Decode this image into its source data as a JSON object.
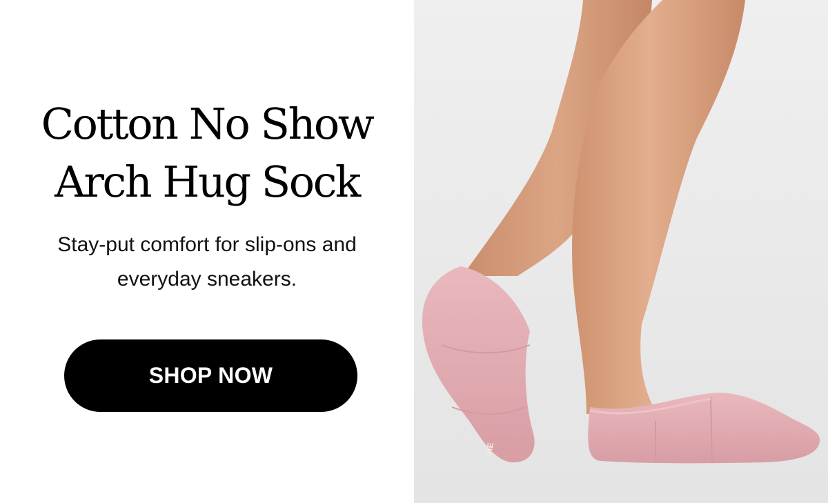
{
  "promo": {
    "headline_line1": "Cotton No Show",
    "headline_line2": "Arch Hug Sock",
    "subhead_line1": "Stay-put comfort for slip-ons and",
    "subhead_line2": "everyday sneakers.",
    "cta_label": "SHOP NOW"
  },
  "photo": {
    "sock_logo_text": "ME"
  },
  "colors": {
    "background": "#ffffff",
    "photo_background": "#ececec",
    "cta_background": "#000000",
    "cta_text": "#ffffff",
    "skin": "#d9a07e",
    "sock": "#e2aeb3"
  }
}
